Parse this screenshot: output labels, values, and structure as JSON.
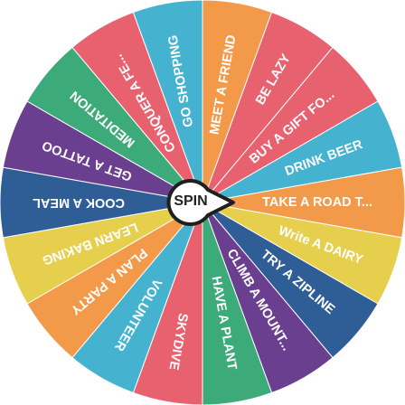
{
  "wheel": {
    "spin_label": "SPIN",
    "segments": [
      {
        "label": "MEET A FRIEND",
        "color": "#f29a4a"
      },
      {
        "label": "BE LAZY",
        "color": "#e8616f"
      },
      {
        "label": "BUY A GIFT FO...",
        "color": "#e8616f"
      },
      {
        "label": "DRINK BEER",
        "color": "#45b3cf"
      },
      {
        "label": "TAKE A ROAD T...",
        "color": "#f29a4a"
      },
      {
        "label": "Write A DAIRY",
        "color": "#e7cf4e"
      },
      {
        "label": "TRY A ZIPLINE",
        "color": "#2f5d95"
      },
      {
        "label": "CLIMB A MOUNT...",
        "color": "#6b3f8f"
      },
      {
        "label": "HAVE A PLANT",
        "color": "#3daa7a"
      },
      {
        "label": "SKYDIVE",
        "color": "#e8616f"
      },
      {
        "label": "VOLUNTEER",
        "color": "#45b3cf"
      },
      {
        "label": "PLAN A PARTY",
        "color": "#f29a4a"
      },
      {
        "label": "LEARN BAKING",
        "color": "#e7cf4e"
      },
      {
        "label": "COOK A MEAL",
        "color": "#2f5d95"
      },
      {
        "label": "GET A TATTOO",
        "color": "#6b3f8f"
      },
      {
        "label": "MEDITATION",
        "color": "#3daa7a"
      },
      {
        "label": "CONQUER A FE...",
        "color": "#e8616f"
      },
      {
        "label": "GO SHOPPING",
        "color": "#45b3cf"
      }
    ]
  }
}
